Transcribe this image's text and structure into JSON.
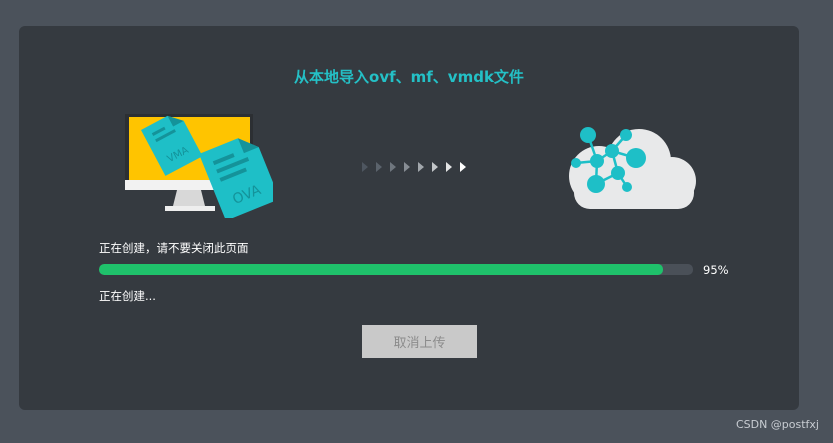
{
  "dialog": {
    "title": "从本地导入ovf、mf、vmdk文件",
    "status_creating_warning": "正在创建，请不要关闭此页面",
    "progress_percent": 95,
    "progress_label": "95%",
    "status_creating": "正在创建...",
    "cancel_label": "取消上传"
  },
  "illustration": {
    "file_a_label": "VMA",
    "file_b_label": "OVA",
    "source_icon": "computer-icon",
    "target_icon": "cloud-network-icon",
    "arrows_icon": "transfer-arrows-icon"
  },
  "colors": {
    "accent": "#24c0c6",
    "progress": "#1fc16b",
    "screen": "#ffc400",
    "dialog_bg": "#353a40",
    "page_bg": "#4b525b"
  },
  "watermark": "CSDN @postfxj"
}
